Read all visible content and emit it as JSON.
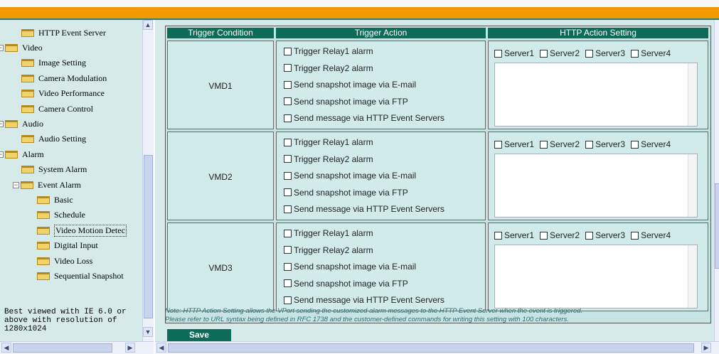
{
  "tree": {
    "items": [
      {
        "label": "HTTP Event Server",
        "level": 2
      },
      {
        "label": "Video",
        "level": 1,
        "expander": "−"
      },
      {
        "label": "Image Setting",
        "level": 2
      },
      {
        "label": "Camera Modulation",
        "level": 2
      },
      {
        "label": "Video Performance",
        "level": 2
      },
      {
        "label": "Camera Control",
        "level": 2
      },
      {
        "label": "Audio",
        "level": 1,
        "expander": "−"
      },
      {
        "label": "Audio Setting",
        "level": 2
      },
      {
        "label": "Alarm",
        "level": 1,
        "expander": "−"
      },
      {
        "label": "System Alarm",
        "level": 2
      },
      {
        "label": "Event Alarm",
        "level": 2,
        "expander": "−"
      },
      {
        "label": "Basic",
        "level": 3
      },
      {
        "label": "Schedule",
        "level": 3
      },
      {
        "label": "Video Motion Detec",
        "level": 3
      },
      {
        "label": "Digital Input",
        "level": 3
      },
      {
        "label": "Video Loss",
        "level": 3
      },
      {
        "label": "Sequential Snapshot",
        "level": 3
      }
    ],
    "hint": "Best viewed with IE 6.0 or\nabove with resolution of\n1280x1024"
  },
  "table": {
    "headers": [
      "Trigger Condition",
      "Trigger Action",
      "HTTP Action Setting"
    ],
    "rows": [
      {
        "condition": "VMD1"
      },
      {
        "condition": "VMD2"
      },
      {
        "condition": "VMD3"
      }
    ],
    "actions": [
      "Trigger Relay1 alarm",
      "Trigger Relay2 alarm",
      "Send snapshot image via E-mail",
      "Send snapshot image via FTP",
      "Send message via HTTP Event Servers"
    ],
    "servers": [
      "Server1",
      "Server2",
      "Server3",
      "Server4"
    ]
  },
  "note": {
    "line1": "Note: HTTP Action Setting allows the VPort sending the customized alarm messages to the HTTP Event Server when the event is triggered.",
    "line2": "Please refer to URL syntax being defined in RFC 1738 and the customer-defined commands for writing this setting with 100 characters."
  },
  "save_label": "Save",
  "colors": {
    "accent": "#f39a00",
    "header": "#0d6c57",
    "panel": "#d6eaea"
  }
}
